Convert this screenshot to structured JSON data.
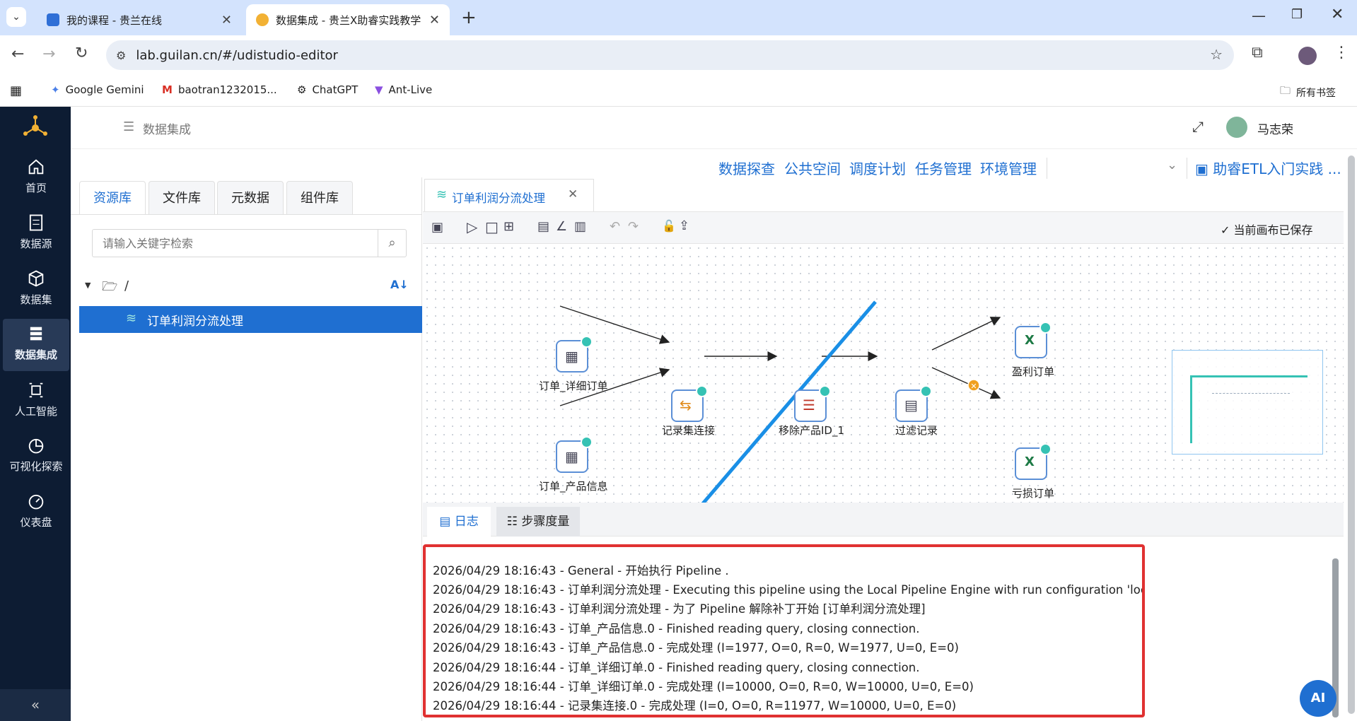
{
  "browser": {
    "tabs": [
      {
        "title": "我的课程 - 贵兰在线",
        "active": false
      },
      {
        "title": "数据集成 - 贵兰X助睿实践教学",
        "active": true
      }
    ],
    "url": "lab.guilan.cn/#/udistudio-editor",
    "bookmarks": [
      "Google Gemini",
      "baotran1232015...",
      "ChatGPT",
      "Ant-Live"
    ],
    "all_bookmarks": "所有书签"
  },
  "sidebar": {
    "items": [
      {
        "label": "首页",
        "icon": "home-icon"
      },
      {
        "label": "数据源",
        "icon": "datasource-icon"
      },
      {
        "label": "数据集",
        "icon": "dataset-icon"
      },
      {
        "label": "数据集成",
        "icon": "integration-icon"
      },
      {
        "label": "人工智能",
        "icon": "ai-icon"
      },
      {
        "label": "可视化探索",
        "icon": "chart-pie-icon"
      },
      {
        "label": "仪表盘",
        "icon": "dashboard-icon"
      }
    ],
    "collapse": "«"
  },
  "header": {
    "breadcrumb": "数据集成",
    "user": "马志荣"
  },
  "topmenu": {
    "items": [
      "数据探查",
      "公共空间",
      "调度计划",
      "任务管理",
      "环境管理"
    ],
    "project": "助睿ETL入门实践 ..."
  },
  "leftpanel": {
    "tabs": [
      "资源库",
      "文件库",
      "元数据",
      "组件库"
    ],
    "search_placeholder": "请输入关键字检索",
    "root": "/",
    "tree_item": "订单利润分流处理"
  },
  "editor": {
    "tab_title": "订单利润分流处理",
    "saved_status": "当前画布已保存",
    "nodes": [
      {
        "label": "订单_详细订单"
      },
      {
        "label": "订单_产品信息"
      },
      {
        "label": "记录集连接"
      },
      {
        "label": "移除产品ID_1"
      },
      {
        "label": "过滤记录"
      },
      {
        "label": "盈利订单"
      },
      {
        "label": "亏损订单"
      }
    ],
    "bottom_tabs": [
      "日志",
      "步骤度量"
    ]
  },
  "log": {
    "lines": [
      "2026/04/29 18:16:43 - General - 开始执行 Pipeline .",
      "2026/04/29 18:16:43 - 订单利润分流处理 - Executing this pipeline using the Local Pipeline Engine with run configuration 'local'",
      "2026/04/29 18:16:43 - 订单利润分流处理 - 为了 Pipeline 解除补丁开始 [订单利润分流处理]",
      "2026/04/29 18:16:43 - 订单_产品信息.0 - Finished reading query, closing connection.",
      "2026/04/29 18:16:43 - 订单_产品信息.0 - 完成处理 (I=1977, O=0, R=0, W=1977, U=0, E=0)",
      "2026/04/29 18:16:44 - 订单_详细订单.0 - Finished reading query, closing connection.",
      "2026/04/29 18:16:44 - 订单_详细订单.0 - 完成处理 (I=10000, O=0, R=0, W=10000, U=0, E=0)",
      "2026/04/29 18:16:44 - 记录集连接.0 - 完成处理 (I=0, O=0, R=11977, W=10000, U=0, E=0)"
    ]
  },
  "ai_button": "AI",
  "colors": {
    "accent": "#1f6fd1",
    "sidebar": "#0d1c33",
    "highlight": "#e03131",
    "check": "#35c2b4"
  }
}
